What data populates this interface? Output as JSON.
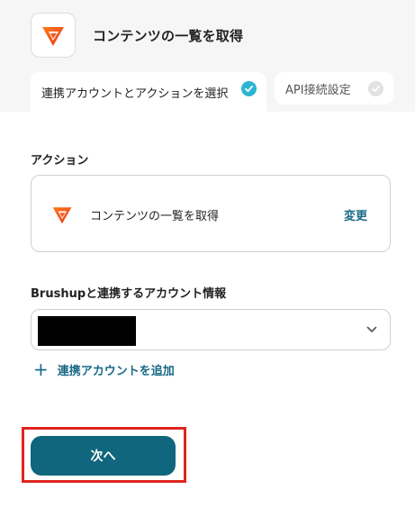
{
  "header": {
    "title": "コンテンツの一覧を取得",
    "app_icon": "brushup-logo-icon"
  },
  "tabs": [
    {
      "label": "連携アカウントとアクションを選択",
      "state": "active",
      "check_color": "#2bb5d2"
    },
    {
      "label": "API接続設定",
      "state": "inactive",
      "check_color": "#e2e2e2"
    }
  ],
  "action_section": {
    "label": "アクション",
    "action_name": "コンテンツの一覧を取得",
    "change_label": "変更"
  },
  "account_section": {
    "label": "Brushupと連携するアカウント情報",
    "selected_value": "",
    "add_account_label": "連携アカウントを追加"
  },
  "footer": {
    "next_label": "次へ",
    "button_color": "#10667d",
    "highlight_color": "#e0241f"
  }
}
